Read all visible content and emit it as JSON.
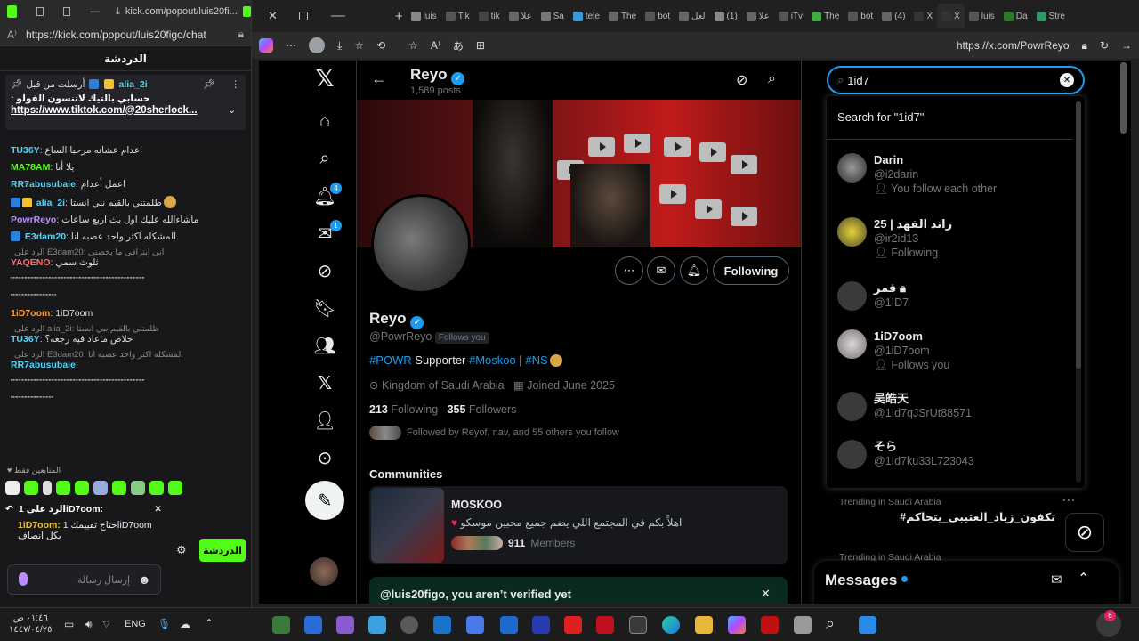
{
  "kick": {
    "tab_title": "kick.com/popout/luis20fi...",
    "url": "https://kick.com/popout/luis20figo/chat",
    "chat_header": "الدردشة",
    "pinned": {
      "sent_by_label": "أرسلت من قبل",
      "sender": "alia_2i",
      "message_line": ": حسابي بالتيك لاتنسون الفولو",
      "link": "https://www.tiktok.com/@20sherlock..."
    },
    "messages": [
      {
        "user": "TU36Y",
        "color": "#54d3f5",
        "text": "اعدام عشانه مرحبا الساع"
      },
      {
        "user": "MA78AM",
        "color": "#53fc18",
        "text": "يلا أنا"
      },
      {
        "user": "RR7abusubaie",
        "color": "#54d3f5",
        "text": "اعمل أعدام"
      },
      {
        "user": "alia_2i",
        "color": "#54d3f5",
        "text": "ظلمتني بالقيم نبي انستا"
      },
      {
        "user": "PowrReyo",
        "color": "#b98cff",
        "text": "ماشاءالله عليك اول بث اربع ساعات"
      },
      {
        "user": "E3dam20",
        "color": "#54d3f5",
        "text": "المشكله اكثر واحد عصبه انا"
      },
      {
        "reply": "الرد على E3dam20: اني إبتراقي ما يخصني",
        "user": "YAQENO",
        "color": "#ff6b6b",
        "text": "ثلوث سمي"
      },
      {
        "user": "",
        "color": "#ddd",
        "text": "\"\"\"\"\"\"\"\"\"\"\"\"\"\"\"\"\"\"\"\"\"\"\"\"\"\"\"\"\"\"\"\"\"\"\"\"\"\"\"\"\"\"\"\"\"\"\"\"\"\"\"\"\""
      },
      {
        "user": "",
        "color": "#ddd",
        "text": "\"\"\"\"\"\"\"\"\"\"\"\"\"\"\"\"\"\""
      },
      {
        "user": "1iD7oom",
        "color": "#ff9a2e",
        "text": "1iD7oom"
      },
      {
        "reply": "الرد على alia_2i: ظلمتني بالقيم نبي انستا",
        "user": "TU36Y",
        "color": "#54d3f5",
        "text": "خلاص ماعاد فيه رجعه؟"
      },
      {
        "reply": "الرد على E3dam20: المشكله اكثر واحد عصبه انا",
        "user": "RR7abusubaie",
        "color": "#54d3f5",
        "text": ""
      },
      {
        "user": "",
        "color": "#ddd",
        "text": "\"\"\"\"\"\"\"\"\"\"\"\"\"\"\"\"\"\"\"\"\"\"\"\"\"\"\"\"\"\"\"\"\"\"\"\"\"\"\"\"\"\"\"\"\"\"\"\"\"\"\"\"\""
      },
      {
        "user": "",
        "color": "#ddd",
        "text": "\"\"\"\"\"\"\"\"\"\"\"\"\"\"\"\"\""
      }
    ],
    "emote_label": "المتابعين فقط",
    "reply_to": "الرد على 1iD7oom:",
    "reply_user": "1iD7oom:",
    "reply_text": "احتاج تقييمك 1iD7oom",
    "reply_text2": "بكل انصاف",
    "input_placeholder": "إرسال رسالة",
    "send_label": "الدردشة"
  },
  "browser": {
    "tabs": [
      "luis",
      "Tik",
      "tik",
      "علا",
      "Sa",
      "tele",
      "The",
      "bot",
      "لعل",
      "(1)",
      "علا",
      "iTv",
      "The",
      "bot",
      "(4)",
      "X",
      "X",
      "luis",
      "Da",
      "Stre"
    ],
    "url": "https://x.com/PowrReyo"
  },
  "profile": {
    "name": "Reyo",
    "posts": "1,589 posts",
    "handle": "@PowrReyo",
    "follows_you": "Follows you",
    "bio_tag1": "#POWR",
    "bio_text": " Supporter ",
    "bio_tag2": "#Moskoo",
    "bio_sep": " | ",
    "bio_tag3": "#NS",
    "location": "Kingdom of Saudi Arabia",
    "joined": "Joined June 2025",
    "following_count": "213",
    "following_label": "Following",
    "followers_count": "355",
    "followers_label": "Followers",
    "followed_by": "Followed by Reyof, nav, and 55 others you follow",
    "following_button": "Following",
    "communities_title": "Communities",
    "community_name": "MOSKOO",
    "community_desc": "اهلاً بكم في المجتمع اللي يضم جميع محبين موسكو",
    "community_members_count": "911",
    "community_members_label": "Members",
    "verify_banner": "@luis20figo, you aren’t verified yet"
  },
  "nav_badges": {
    "notifications": "4",
    "messages": "1"
  },
  "search": {
    "query": "1id7",
    "search_for": "Search for \"1id7\"",
    "results": [
      {
        "name": "Darin",
        "handle": "@i2darin",
        "sub": "You follow each other"
      },
      {
        "name": "راند الفهد | 25",
        "handle": "@ir2id13",
        "sub": "Following"
      },
      {
        "name": "قمر",
        "handle": "@1ID7",
        "sub": ""
      },
      {
        "name": "1iD7oom",
        "handle": "@1iD7oom",
        "sub": "Follows you"
      },
      {
        "name": "吴皓天",
        "handle": "@1Id7qJSrUt88571",
        "sub": ""
      },
      {
        "name": "そら",
        "handle": "@1Id7ku33L723043",
        "sub": ""
      }
    ]
  },
  "trends": [
    {
      "label": "Trending in Saudi Arabia",
      "title": "#تكفون_زياد_العتيبي_يتحاكم"
    },
    {
      "label": "Trending in Saudi Arabia",
      "title": ""
    }
  ],
  "messages_drawer": {
    "title": "Messages"
  },
  "taskbar": {
    "time": "٠١:٤٦ ص",
    "date": "١٤٤٧/٠٤/٢٥",
    "lang": "ENG",
    "notif_count": "6"
  },
  "colors": {
    "accent": "#1d9bf0",
    "kick_green": "#53fc18"
  }
}
